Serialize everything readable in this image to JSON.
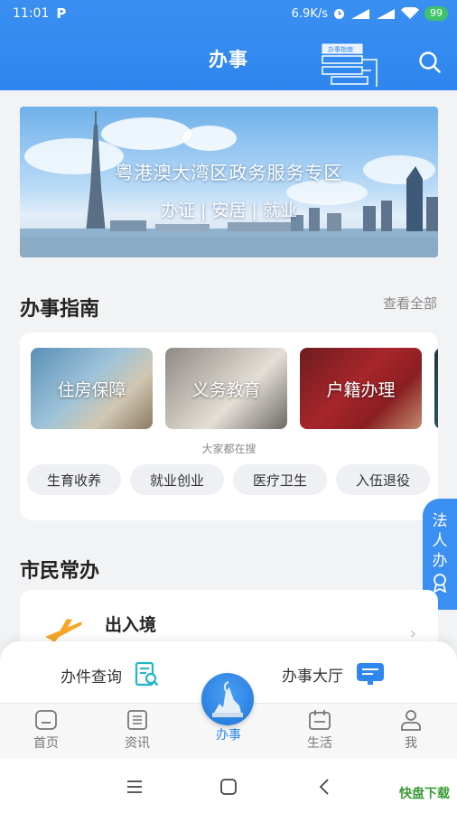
{
  "status_bar": {
    "time": "11:01",
    "net_speed": "6.9K/s",
    "battery": "99"
  },
  "header": {
    "title": "办事",
    "guide_badge": "办事指南"
  },
  "banner": {
    "title": "粤港澳大湾区政务服务专区",
    "subtitle": "办证 | 安居 | 就业"
  },
  "guide_section": {
    "title": "办事指南",
    "see_all": "查看全部",
    "tiles": [
      "住房保障",
      "义务教育",
      "户籍办理"
    ],
    "search_hint": "大家都在搜",
    "chips": [
      "生育收养",
      "就业创业",
      "医疗卫生",
      "入伍退役"
    ]
  },
  "float_button": {
    "label_chars": [
      "法",
      "人",
      "办"
    ]
  },
  "citizen_section": {
    "title": "市民常办",
    "item_label": "出入境"
  },
  "quick_panel": {
    "query_label": "办件查询",
    "hall_label": "办事大厅"
  },
  "tabbar": {
    "tabs": [
      "首页",
      "资讯",
      "办事",
      "生活",
      "我"
    ],
    "active_index": 2
  },
  "colors": {
    "primary": "#2e86ee",
    "accent_cyan": "#21b6c8",
    "orange": "#f5a623"
  },
  "watermark": "快盘下载"
}
